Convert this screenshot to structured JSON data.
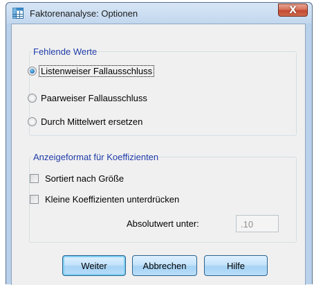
{
  "window": {
    "title": "Faktorenanalyse: Optionen",
    "close_label": "X"
  },
  "missing_values": {
    "legend": "Fehlende Werte",
    "options": [
      {
        "label": "Listenweiser Fallausschluss",
        "selected": true
      },
      {
        "label": "Paarweiser Fallausschluss",
        "selected": false
      },
      {
        "label": "Durch Mittelwert ersetzen",
        "selected": false
      }
    ]
  },
  "coefficient_display": {
    "legend": "Anzeigeformat für Koeffizienten",
    "sort_by_size": {
      "label": "Sortiert nach Größe",
      "checked": false
    },
    "suppress_small": {
      "label": "Kleine Koeffizienten unterdrücken",
      "checked": false
    },
    "absolute_value": {
      "label": "Absolutwert unter:",
      "value": ".10"
    }
  },
  "buttons": {
    "continue": "Weiter",
    "cancel": "Abbrechen",
    "help": "Hilfe"
  },
  "colors": {
    "legend_text": "#1f3ca8",
    "window_frame": "#b9d1ea",
    "close_button": "#c24a32"
  }
}
